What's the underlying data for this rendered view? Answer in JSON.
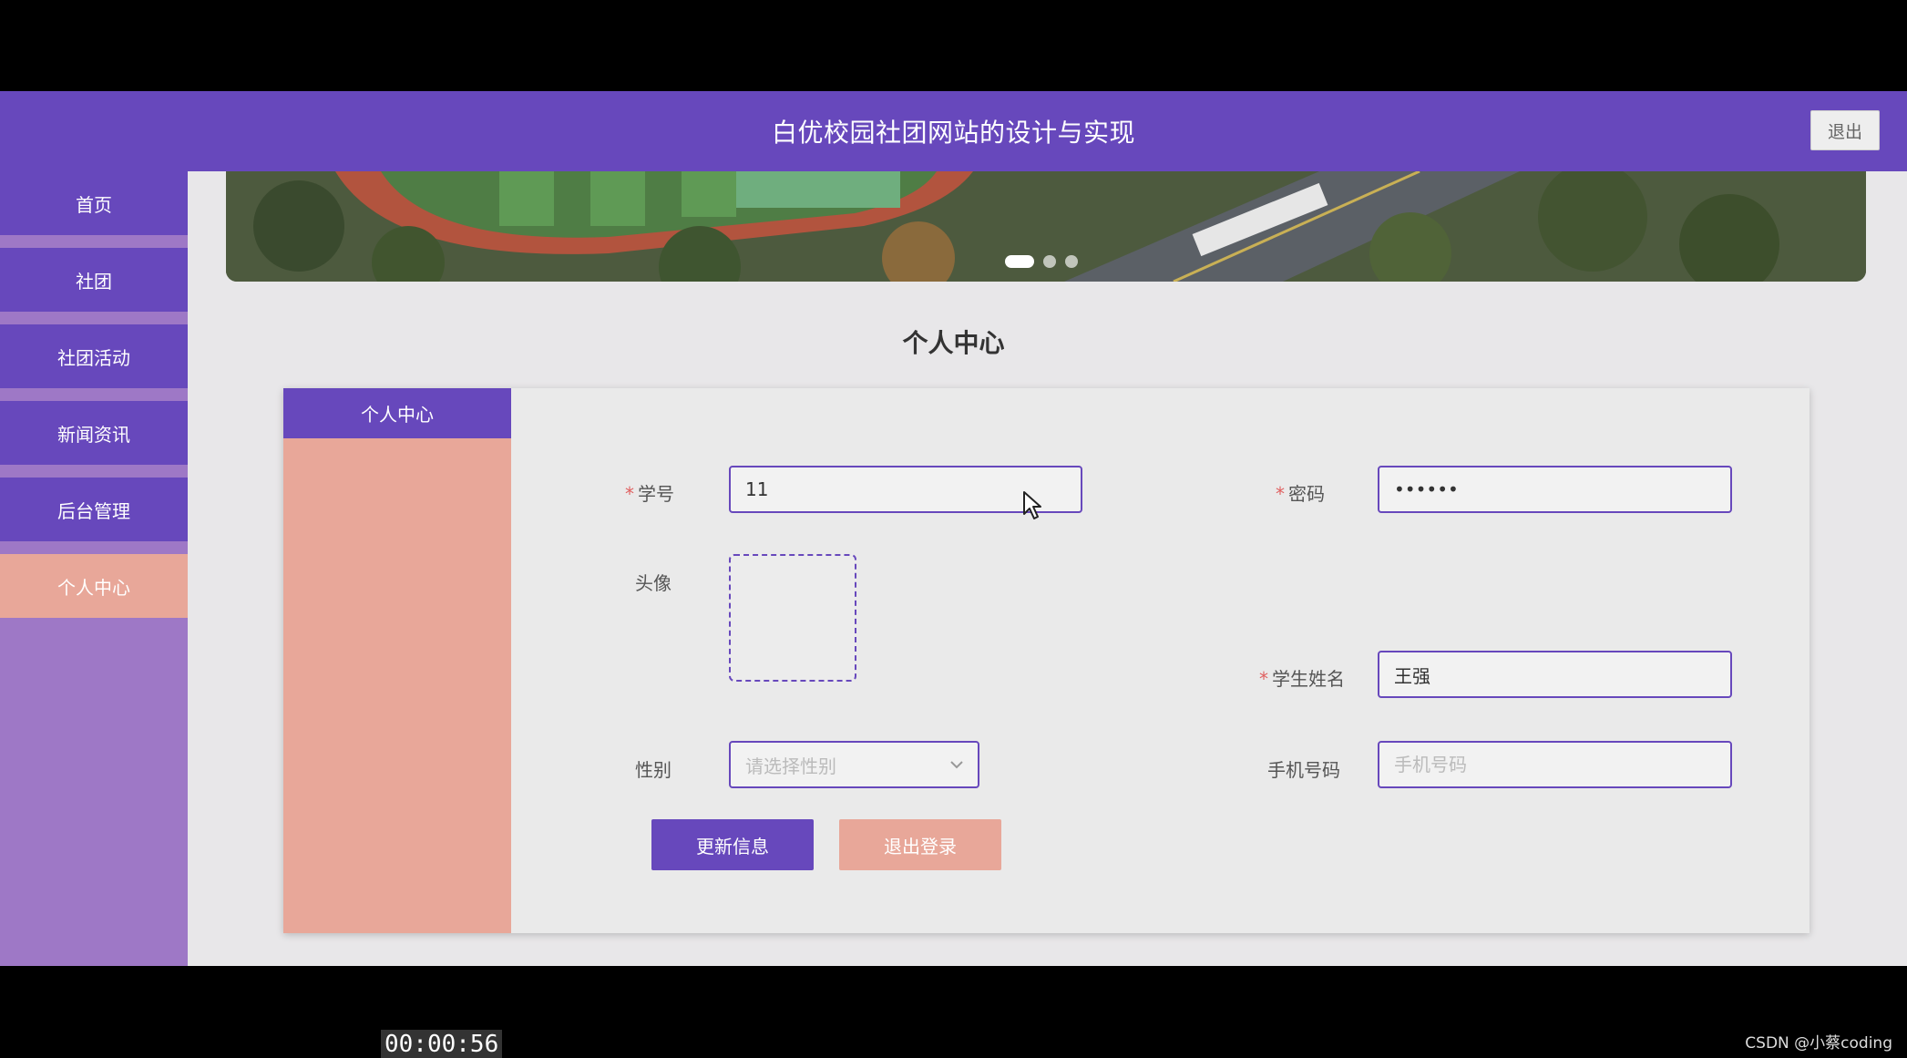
{
  "header": {
    "title": "白优校园社团网站的设计与实现",
    "logout_label": "退出"
  },
  "sidebar": {
    "items": [
      {
        "label": "首页"
      },
      {
        "label": "社团"
      },
      {
        "label": "社团活动"
      },
      {
        "label": "新闻资讯"
      },
      {
        "label": "后台管理"
      },
      {
        "label": "个人中心",
        "active": true
      }
    ]
  },
  "banner": {
    "active_slide": 1,
    "slide_count": 3
  },
  "page": {
    "title": "个人中心"
  },
  "card": {
    "tab_label": "个人中心"
  },
  "form": {
    "student_id": {
      "required_mark": "*",
      "label": "学号",
      "value": "11"
    },
    "password": {
      "required_mark": "*",
      "label": "密码",
      "value": "••••••"
    },
    "avatar": {
      "label": "头像"
    },
    "student_name": {
      "required_mark": "*",
      "label": "学生姓名",
      "value": "王强"
    },
    "gender": {
      "label": "性别",
      "placeholder": "请选择性别"
    },
    "phone": {
      "label": "手机号码",
      "placeholder": "手机号码"
    },
    "update_label": "更新信息",
    "logout_label": "退出登录"
  },
  "video": {
    "timestamp": "00:00:56"
  },
  "watermark": "CSDN @小蔡coding",
  "colors": {
    "primary": "#6748bc",
    "accent": "#e8a799",
    "sidebar_bg": "#9e78c6",
    "required": "#e06060"
  }
}
